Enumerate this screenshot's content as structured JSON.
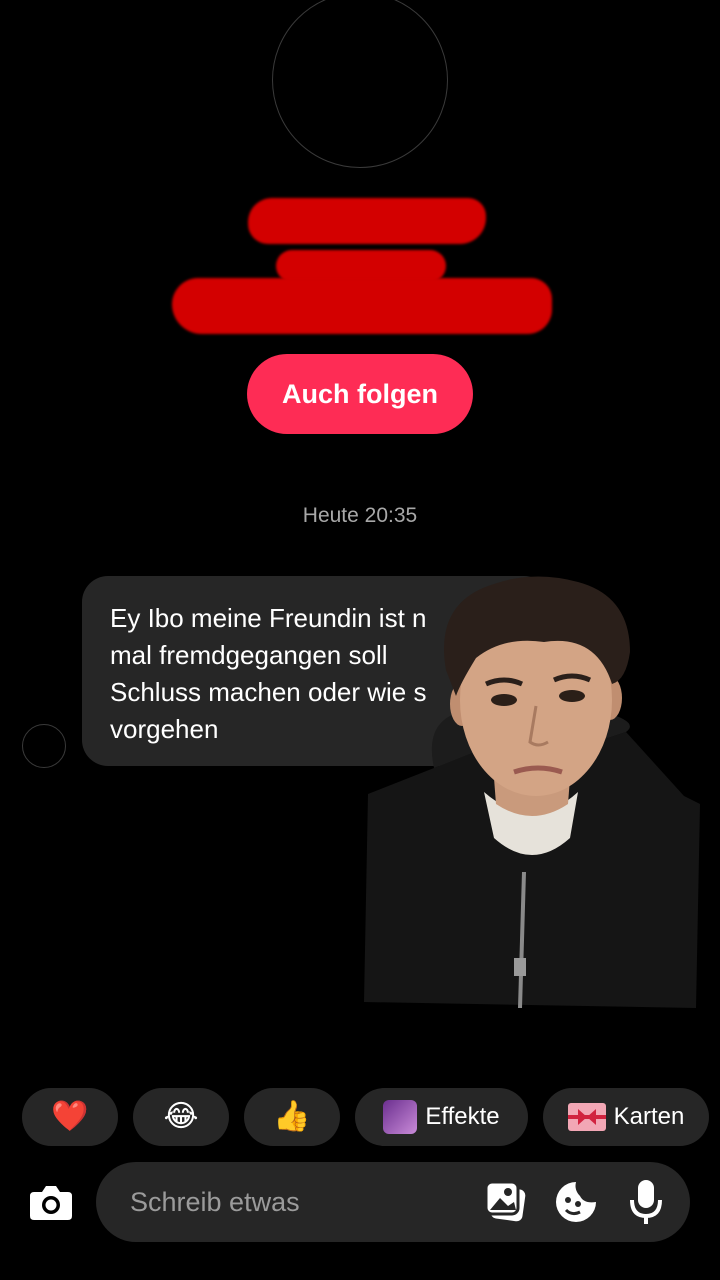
{
  "profile": {
    "follow_button_label": "Auch folgen"
  },
  "chat": {
    "timestamp": "Heute 20:35",
    "message_lines": [
      "Ey Ibo meine Freundin ist n",
      "mal fremdgegangen soll",
      "Schluss machen oder wie s",
      "vorgehen"
    ]
  },
  "quick_reactions": [
    {
      "type": "emoji",
      "glyph": "❤️",
      "icon": "heart-icon"
    },
    {
      "type": "emoji",
      "glyph": "😂",
      "icon": "laughing-emoji-icon"
    },
    {
      "type": "emoji",
      "glyph": "👍",
      "icon": "thumbs-up-icon"
    },
    {
      "type": "label",
      "label": "Effekte",
      "icon": "effects-thumbnail-icon"
    },
    {
      "type": "label",
      "label": "Karten",
      "icon": "gift-card-icon"
    }
  ],
  "composer": {
    "placeholder": "Schreib etwas",
    "icons": [
      "camera-icon",
      "image-icon",
      "sticker-icon",
      "microphone-icon"
    ]
  },
  "colors": {
    "accent": "#fe2c55",
    "bubble": "#262626",
    "redaction": "#d30000"
  }
}
